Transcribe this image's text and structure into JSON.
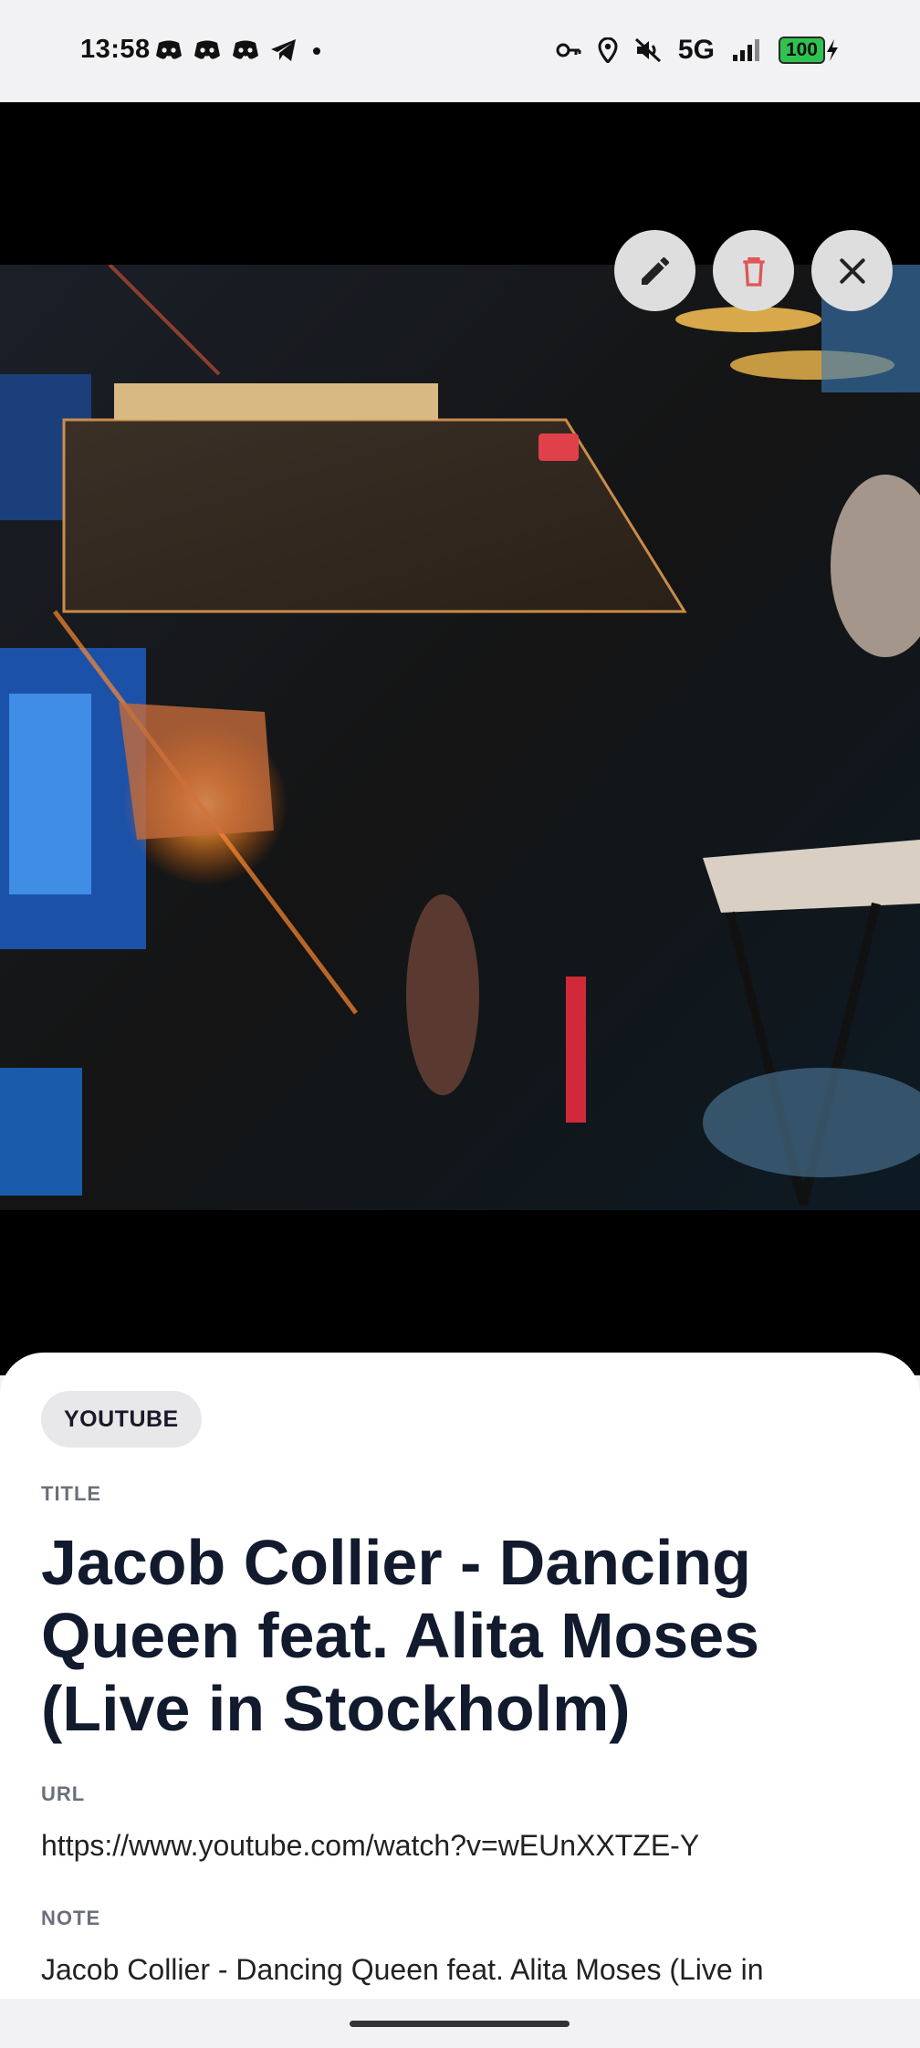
{
  "status_bar": {
    "time": "13:58",
    "left_icons": [
      "discord-icon",
      "discord-icon",
      "discord-icon",
      "telegram-icon",
      "dot-icon"
    ],
    "right_icons": [
      "vpn-key-icon",
      "location-icon",
      "mute-icon"
    ],
    "network": "5G",
    "battery": "100"
  },
  "media": {
    "image": "concert-stage-photo",
    "actions": [
      {
        "icon": "pencil-icon",
        "color": "#222222"
      },
      {
        "icon": "trash-icon",
        "color": "#e05555"
      },
      {
        "icon": "close-icon",
        "color": "#222222"
      }
    ]
  },
  "details": {
    "source": "YOUTUBE",
    "title_label": "TITLE",
    "title": "Jacob Collier - Dancing Queen feat. Alita Moses (Live in Stockholm)",
    "url_label": "URL",
    "url": "https://www.youtube.com/watch?v=wEUnXXTZE-Y",
    "note_label": "NOTE",
    "note": "Jacob Collier - Dancing Queen feat. Alita Moses (Live in"
  },
  "colors": {
    "accent_delete": "#e05555",
    "title_text": "#121a2e",
    "battery": "#2fc24f"
  }
}
